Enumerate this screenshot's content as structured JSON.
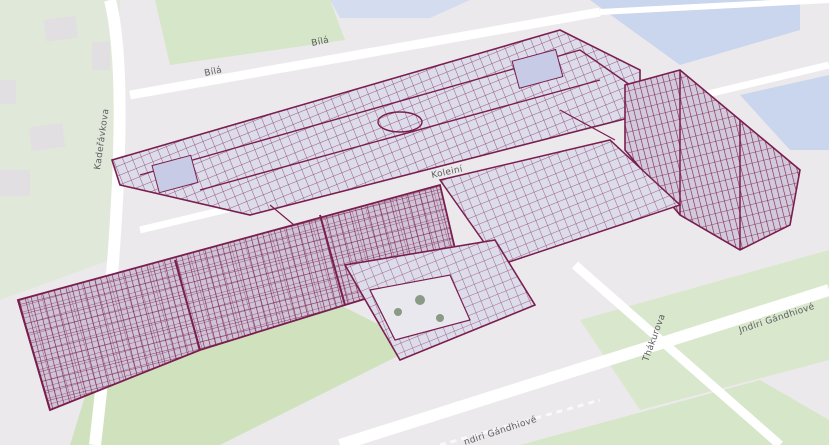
{
  "map": {
    "streets": {
      "bila_1": "Bílá",
      "bila_2": "Bílá",
      "kolejni": "Koleiní",
      "kafkova": "Kadeřávkova",
      "thakurova": "Thákurova",
      "gandhi_1": "Jndiri Gándhiové",
      "gandhi_2": "ndiri Gándhiové"
    },
    "colors": {
      "ground": "#ece9ec",
      "grass": "#d6e6c8",
      "water": "#c9d6ee",
      "road": "#ffffff",
      "building_block": "#e4e2e4",
      "model_wire": "#7a1e4e",
      "model_floor": "#dcdcea"
    },
    "layers": [
      "basemap",
      "3d-building-model"
    ]
  }
}
